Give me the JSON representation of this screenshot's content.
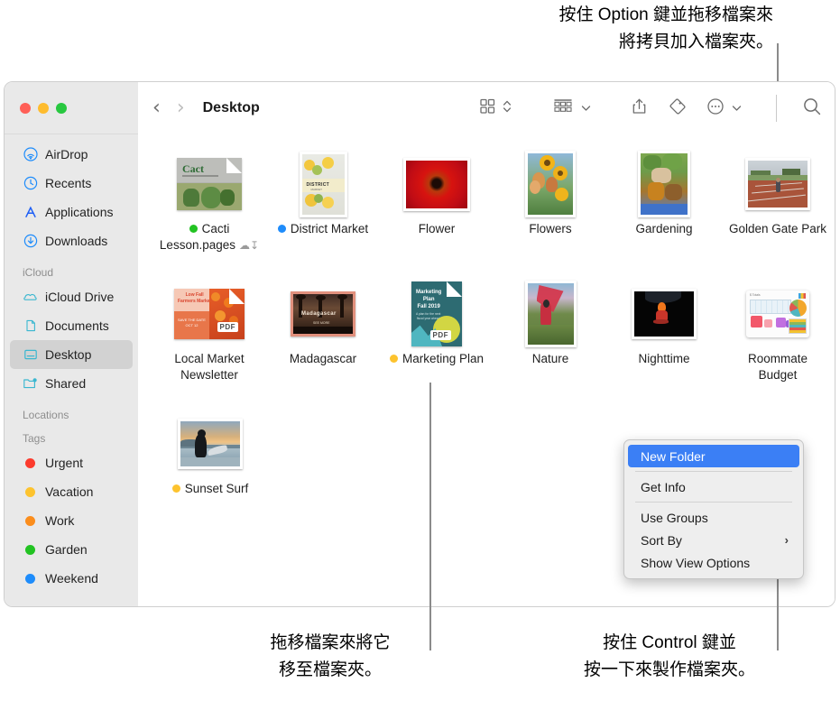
{
  "annotations": {
    "top_right": "按住 Option 鍵並拖移檔案來\n將拷貝加入檔案夾。",
    "bottom_left": "拖移檔案來將它\n移至檔案夾。",
    "bottom_right": "按住 Control 鍵並\n按一下來製作檔案夾。"
  },
  "window": {
    "traffic_lights": [
      "close",
      "minimize",
      "maximize"
    ],
    "toolbar": {
      "back_label": "‹",
      "forward_label": "›",
      "title": "Desktop",
      "view_mode_icon": "grid-view-icon",
      "view_stepper_icon": "up-down-chevron-icon",
      "group_icon": "group-by-icon",
      "group_chevron": "chevron-down-icon",
      "share_icon": "share-icon",
      "tag_icon": "tag-icon",
      "more_icon": "more-ellipsis-icon",
      "more_chevron": "chevron-down-icon",
      "search_icon": "search-icon"
    }
  },
  "sidebar": {
    "favorites": [
      {
        "label": "AirDrop",
        "icon": "airdrop-icon"
      },
      {
        "label": "Recents",
        "icon": "clock-icon"
      },
      {
        "label": "Applications",
        "icon": "applications-icon"
      },
      {
        "label": "Downloads",
        "icon": "download-icon"
      }
    ],
    "icloud_header": "iCloud",
    "icloud": [
      {
        "label": "iCloud Drive",
        "icon": "cloud-icon"
      },
      {
        "label": "Documents",
        "icon": "document-icon"
      },
      {
        "label": "Desktop",
        "icon": "desktop-icon",
        "selected": true
      },
      {
        "label": "Shared",
        "icon": "shared-folder-icon"
      }
    ],
    "locations_header": "Locations",
    "tags_header": "Tags",
    "tags": [
      {
        "label": "Urgent",
        "color": "#fc3b2d"
      },
      {
        "label": "Vacation",
        "color": "#fdc32e"
      },
      {
        "label": "Work",
        "color": "#fb8d1c"
      },
      {
        "label": "Garden",
        "color": "#22c322"
      },
      {
        "label": "Weekend",
        "color": "#1e8cfb"
      }
    ]
  },
  "files": {
    "rows": [
      [
        {
          "name_lines": [
            "Cacti",
            "Lesson.pages"
          ],
          "tag_color": "#22c322",
          "cloud": true,
          "kind": "pages-document"
        },
        {
          "name_lines": [
            "District Market"
          ],
          "tag_color": "#1e8cfb",
          "kind": "image"
        },
        {
          "name_lines": [
            "Flower"
          ],
          "kind": "image"
        },
        {
          "name_lines": [
            "Flowers"
          ],
          "kind": "image"
        },
        {
          "name_lines": [
            "Gardening"
          ],
          "kind": "image"
        },
        {
          "name_lines": [
            "Golden Gate Park"
          ],
          "kind": "image"
        }
      ],
      [
        {
          "name_lines": [
            "Local Market",
            "Newsletter"
          ],
          "kind": "pdf-document"
        },
        {
          "name_lines": [
            "Madagascar"
          ],
          "kind": "image"
        },
        {
          "name_lines": [
            "Marketing Plan"
          ],
          "tag_color": "#fdc32e",
          "kind": "pdf-document"
        },
        {
          "name_lines": [
            "Nature"
          ],
          "kind": "image"
        },
        {
          "name_lines": [
            "Nighttime"
          ],
          "kind": "image"
        },
        {
          "name_lines": [
            "Roommate",
            "Budget"
          ],
          "kind": "spreadsheet"
        }
      ],
      [
        {
          "name_lines": [
            "Sunset Surf"
          ],
          "tag_color": "#fdc32e",
          "kind": "image"
        }
      ]
    ]
  },
  "context_menu": {
    "items": [
      {
        "label": "New Folder",
        "highlighted": true
      },
      {
        "divider": true
      },
      {
        "label": "Get Info"
      },
      {
        "divider": true
      },
      {
        "label": "Use Groups"
      },
      {
        "label": "Sort By",
        "submenu": true
      },
      {
        "label": "Show View Options"
      }
    ]
  },
  "colors": {
    "selection_blue": "#3b7ff5",
    "sidebar_bg": "#e9e9e9",
    "sidebar_icon_blue": "#1e8cfb",
    "sidebar_icon_teal": "#3ab7d0"
  }
}
